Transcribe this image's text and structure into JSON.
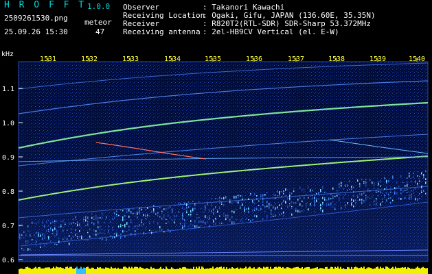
{
  "app": {
    "name": "H R O F F T",
    "version": "1.0.0",
    "filename": "2509261530.png",
    "timestamp": "25.09.26 15:30",
    "count_label": "meteor",
    "count_value": "47"
  },
  "info": {
    "labels": [
      "Observer",
      "Receiving Location",
      "Receiver",
      "Receiving antenna"
    ],
    "values": [
      ": Takanori Kawachi",
      ": Ogaki, Gifu, JAPAN (136.60E, 35.35N)",
      ": R820T2(RTL-SDR) SDR-Sharp 53.372MHz",
      ": 2el-HB9CV Vertical (el. E-W)"
    ]
  },
  "spectrogram": {
    "y_unit": "kHz",
    "y_ticks": [
      "1.1",
      "1.0",
      "0.9",
      "0.8",
      "0.7",
      "0.6"
    ],
    "x_ticks": [
      "1531",
      "1532",
      "1533",
      "1534",
      "1535",
      "1536",
      "1537",
      "1538",
      "1539",
      "1540"
    ],
    "colors": {
      "background": "#000c38",
      "header_cyan": "#00d8d8",
      "tick_yellow": "#ffff40",
      "level_bar": "#f0f000"
    }
  }
}
